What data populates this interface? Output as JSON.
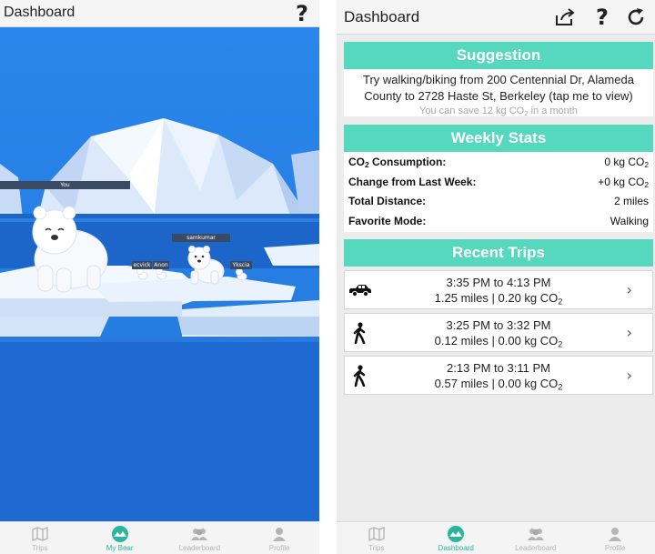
{
  "left": {
    "title": "Dashboard",
    "players": {
      "you": "You",
      "samkumar": "samkumar",
      "ecvick": "ecvick",
      "anon": "Anon",
      "ykscia": "Ykscia"
    },
    "nav": [
      {
        "label": "Trips",
        "icon": "map-icon"
      },
      {
        "label": "My Bear",
        "icon": "bear-mountain-icon",
        "active": true
      },
      {
        "label": "Leaderboard",
        "icon": "people-icon"
      },
      {
        "label": "Profile",
        "icon": "person-icon"
      }
    ]
  },
  "right": {
    "title": "Dashboard",
    "suggestion": {
      "header": "Suggestion",
      "text": "Try walking/biking from 200 Centennial Dr, Alameda County to 2728 Haste St, Berkeley (tap me to view)",
      "save_prefix": "You can save 12 kg CO",
      "save_sub": "2",
      "save_suffix": " in a month"
    },
    "weekly": {
      "header": "Weekly Stats",
      "co2_label_prefix": "CO",
      "co2_label_sub": "2",
      "co2_label_suffix": " Consumption:",
      "co2_value_prefix": "0 kg CO",
      "co2_value_sub": "2",
      "change_label": "Change from Last Week:",
      "change_value_prefix": "+0 kg CO",
      "change_value_sub": "2",
      "distance_label": "Total Distance:",
      "distance_value": "2 miles",
      "mode_label": "Favorite Mode:",
      "mode_value": "Walking"
    },
    "recent": {
      "header": "Recent Trips",
      "trips": [
        {
          "mode_icon": "car-icon",
          "time": "3:35 PM to 4:13 PM",
          "detail": "1.25 miles | 0.20 kg CO",
          "sub": "2"
        },
        {
          "mode_icon": "walking-icon",
          "time": "3:25 PM to 3:32 PM",
          "detail": "0.12 miles | 0.00 kg CO",
          "sub": "2"
        },
        {
          "mode_icon": "walking-icon",
          "time": "2:13 PM to 3:11 PM",
          "detail": "0.57 miles | 0.00 kg CO",
          "sub": "2"
        }
      ]
    },
    "nav": [
      {
        "label": "Trips",
        "icon": "map-icon"
      },
      {
        "label": "Dashboard",
        "icon": "bear-mountain-icon",
        "active": true
      },
      {
        "label": "Leaderboard",
        "icon": "people-icon"
      },
      {
        "label": "Profile",
        "icon": "person-icon"
      }
    ]
  },
  "colors": {
    "accent": "#55d8bd",
    "ocean": "#1f6fd6",
    "active_nav": "#2ab69e"
  }
}
